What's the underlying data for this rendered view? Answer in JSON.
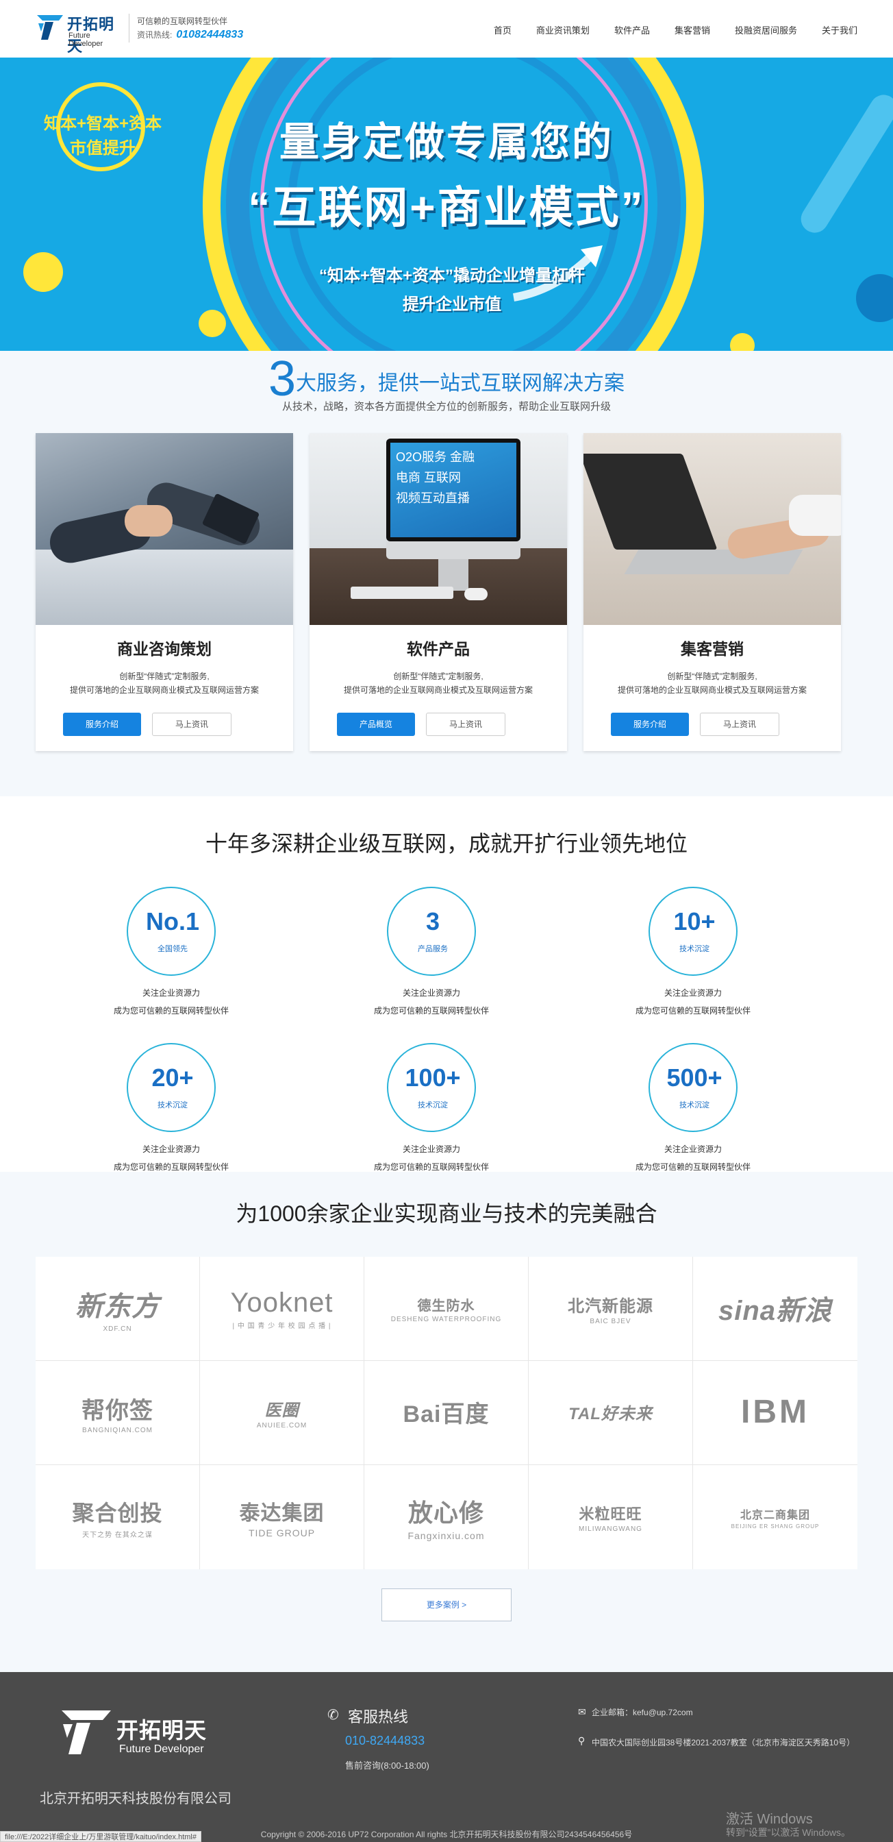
{
  "header": {
    "logo_cn": "开拓明天",
    "logo_en": "Future Developer",
    "tagline": "可信赖的互联网转型伙伴",
    "hotline_label": "资讯热线:",
    "hotline_number": "01082444833",
    "nav": [
      "首页",
      "商业资讯策划",
      "软件产品",
      "集客营销",
      "投融资居间服务",
      "关于我们"
    ]
  },
  "banner": {
    "badge_line1": "知本+智本+资本",
    "badge_line2": "市值提升",
    "headline1": "量身定做专属您的",
    "headline2": "“互联网+商业模式”",
    "sub1": "“知本+智本+资本”撬动企业增量杠杆",
    "sub2": "提升企业市值"
  },
  "services": {
    "title_num": "3",
    "title_rest": "大服务，提供一站式互联网解决方案",
    "subtitle": "从技术，战略，资本各方面提供全方位的创新服务，帮助企业互联网升级",
    "cards": [
      {
        "title": "商业咨询策划",
        "desc1": "创新型“伴随式”定制服务,",
        "desc2": "提供可落地的企业互联网商业模式及互联网运营方案",
        "btn1": "服务介绍",
        "btn2": "马上资讯"
      },
      {
        "title": "软件产品",
        "desc1": "创新型“伴随式”定制服务,",
        "desc2": "提供可落地的企业互联网商业模式及互联网运营方案",
        "btn1": "产品概览",
        "btn2": "马上资讯",
        "screen_l1": "O2O服务 金融",
        "screen_l2": "电商 互联网",
        "screen_l3": "视频互动直播"
      },
      {
        "title": "集客营销",
        "desc1": "创新型“伴随式”定制服务,",
        "desc2": "提供可落地的企业互联网商业模式及互联网运营方案",
        "btn1": "服务介绍",
        "btn2": "马上资讯"
      }
    ]
  },
  "stats": {
    "title": "十年多深耕企业级互联网，成就开扩行业领先地位",
    "items": [
      {
        "num": "No.1",
        "label": "全国领先",
        "d1": "关注企业资源力",
        "d2": "成为您可信赖的互联网转型伙伴"
      },
      {
        "num": "3",
        "label": "产品服务",
        "d1": "关注企业资源力",
        "d2": "成为您可信赖的互联网转型伙伴"
      },
      {
        "num": "10+",
        "label": "技术沉淀",
        "d1": "关注企业资源力",
        "d2": "成为您可信赖的互联网转型伙伴"
      },
      {
        "num": "20+",
        "label": "技术沉淀",
        "d1": "关注企业资源力",
        "d2": "成为您可信赖的互联网转型伙伴"
      },
      {
        "num": "100+",
        "label": "技术沉淀",
        "d1": "关注企业资源力",
        "d2": "成为您可信赖的互联网转型伙伴"
      },
      {
        "num": "500+",
        "label": "技术沉淀",
        "d1": "关注企业资源力",
        "d2": "成为您可信赖的互联网转型伙伴"
      }
    ]
  },
  "clients": {
    "title": "为1000余家企业实现商业与技术的完美融合",
    "logos": [
      {
        "main": "新东方",
        "sub": "XDF.CN"
      },
      {
        "main": "Yooknet",
        "sub": "| 中 国 青 少 年 校 园 点 播 |"
      },
      {
        "main": "德生防水",
        "sub": "DESHENG WATERPROOFING"
      },
      {
        "main": "北汽新能源",
        "sub": "BAIC BJEV"
      },
      {
        "main": "sina新浪",
        "sub": ""
      },
      {
        "main": "帮你签",
        "sub": "BANGNIQIAN.COM"
      },
      {
        "main": "医圈",
        "sub": "ANUIEE.COM"
      },
      {
        "main": "Bai百度",
        "sub": ""
      },
      {
        "main": "TAL好未来",
        "sub": ""
      },
      {
        "main": "IBM",
        "sub": ""
      },
      {
        "main": "聚合创投",
        "sub": "天下之势 在其众之谋"
      },
      {
        "main": "泰达集团",
        "sub": "TIDE GROUP"
      },
      {
        "main": "放心修",
        "sub": "Fangxinxiu.com"
      },
      {
        "main": "米粒旺旺",
        "sub": "MILIWANGWANG"
      },
      {
        "main": "北京二商集团",
        "sub": "BEIJING ER SHANG GROUP"
      }
    ],
    "more": "更多案例 >"
  },
  "footer": {
    "logo_cn": "开拓明天",
    "logo_en": "Future Developer",
    "company": "北京开拓明天科技股份有限公司",
    "hotline_label": "客服热线",
    "hotline_number": "010-82444833",
    "hours": "售前咨询(8:00-18:00)",
    "email": "企业邮箱：kefu@up.72com",
    "address": "中国农大国际创业园38号楼2021-2037教室（北京市海淀区天秀路10号）",
    "copyright": "Copyright © 2006-2016 UP72 Corporation All rights 北京开拓明天科技股份有限公司2434546456456号"
  },
  "overlays": {
    "status_url": "file:///E:/2022详细企业上/万里游联管理/kaituo/index.html#",
    "win1": "激活 Windows",
    "win2": "转到“设置”以激活 Windows。"
  },
  "colors": {
    "accent": "#1583e0",
    "banner": "#16a9e4",
    "yellow": "#ffe63a",
    "footer": "#4b4b4b"
  }
}
